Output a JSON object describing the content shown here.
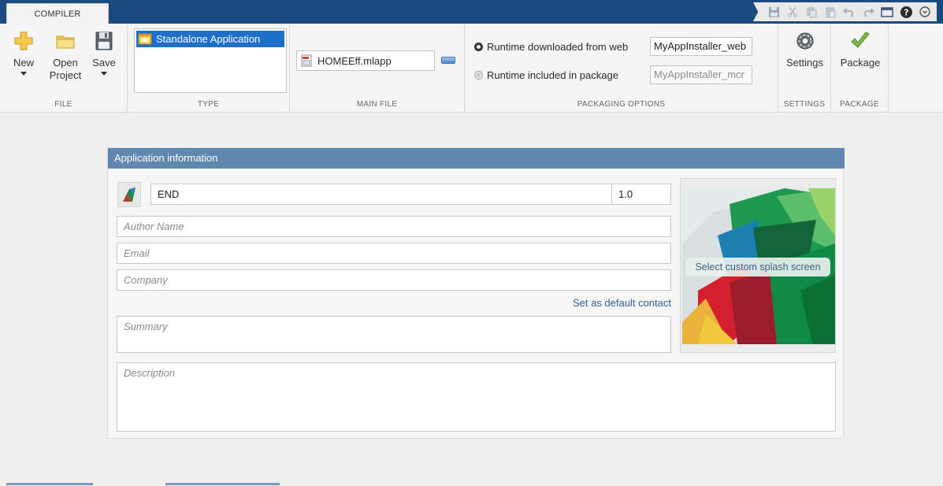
{
  "tab": {
    "label": "COMPILER"
  },
  "toolstrip": {
    "file": {
      "label": "FILE",
      "new_label": "New",
      "open_label_1": "Open",
      "open_label_2": "Project",
      "save_label": "Save"
    },
    "type": {
      "label": "TYPE",
      "selected": "Standalone Application"
    },
    "main_file": {
      "label": "MAIN FILE",
      "file_name": "HOMEEff.mlapp"
    },
    "packaging": {
      "label": "PACKAGING OPTIONS",
      "option_web": "Runtime downloaded from web",
      "option_web_value": "MyAppInstaller_web",
      "option_pkg": "Runtime included in package",
      "option_pkg_value": "MyAppInstaller_mcr"
    },
    "settings": {
      "label": "SETTINGS",
      "button": "Settings"
    },
    "package": {
      "label": "PACKAGE",
      "button": "Package"
    }
  },
  "app_info": {
    "header": "Application information",
    "name": "END",
    "version": "1.0",
    "author_placeholder": "Author Name",
    "email_placeholder": "Email",
    "company_placeholder": "Company",
    "set_default_link": "Set as default contact",
    "summary_placeholder": "Summary",
    "description_placeholder": "Description",
    "splash_caption": "Select custom splash screen"
  },
  "colors": {
    "title_bar": "#1b4a7e",
    "panel_header": "#5f87b0",
    "selection": "#1e6fc9",
    "link": "#2d5e9a"
  }
}
